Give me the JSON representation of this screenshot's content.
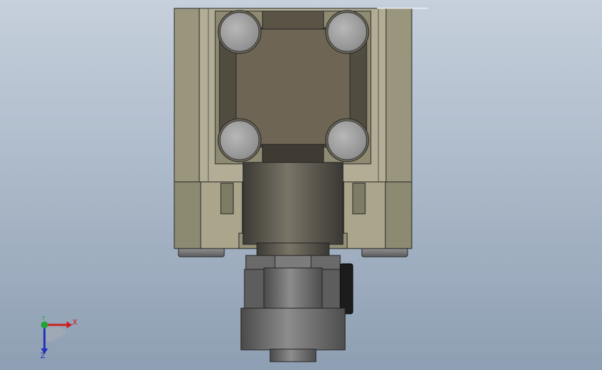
{
  "viewport": {
    "background_top": "#c6d0dc",
    "background_bottom": "#8e9fb3"
  },
  "model": {
    "body_color": "#b2ad94",
    "body_shadow": "#8d8a72",
    "face_color": "#6f6555",
    "bolt_color": "#a9a9a9",
    "metal_color": "#5e5b55",
    "knob_color": "#1c1c1c"
  },
  "triad": {
    "x_label": "X",
    "y_label": "Y",
    "z_label": "Z",
    "x_color": "#cc1f1f",
    "y_color": "#22a336",
    "z_color": "#2030b8"
  }
}
